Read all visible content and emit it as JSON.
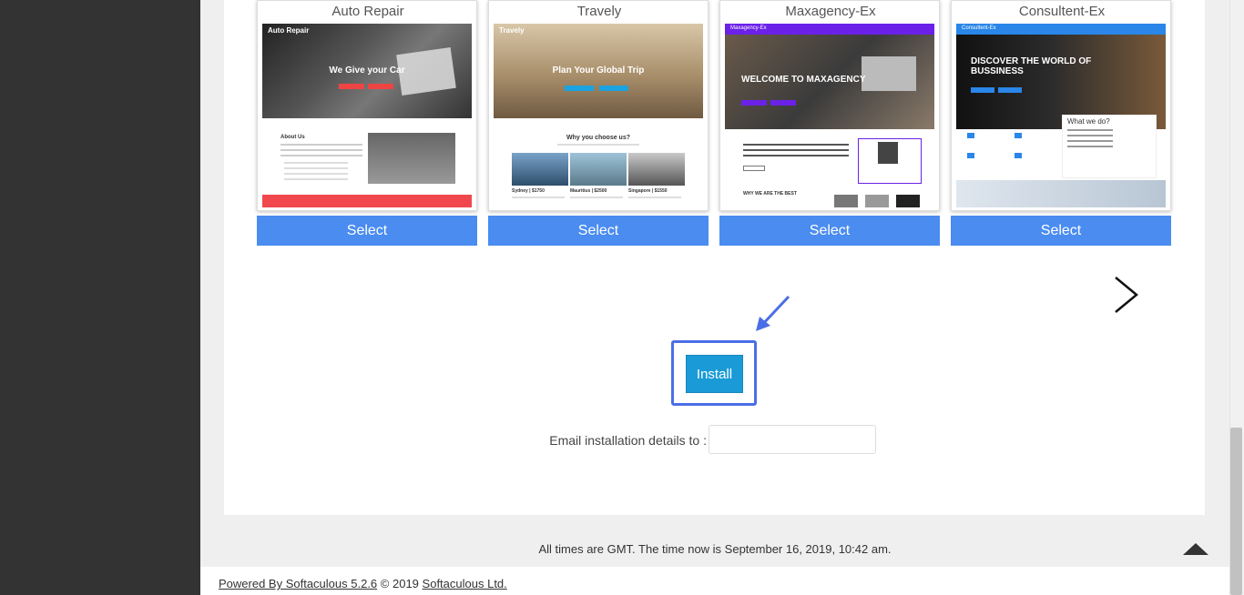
{
  "themes": [
    {
      "title": "Auto Repair",
      "select_label": "Select",
      "hero_text": "We Give your Car",
      "brand": "Auto Repair",
      "section": "About Us"
    },
    {
      "title": "Travely",
      "select_label": "Select",
      "hero_text": "Plan Your Global Trip",
      "brand": "Travely",
      "section": "Why you choose us?",
      "cities": [
        "Sydney | $1750",
        "Mauritius | $2500",
        "Singapore | $1550"
      ]
    },
    {
      "title": "Maxagency-Ex",
      "select_label": "Select",
      "hero_text": "WELCOME TO MAXAGENCY",
      "brand": "Maxagency-Ex",
      "section": "WHY WE ARE THE BEST"
    },
    {
      "title": "Consultent-Ex",
      "select_label": "Select",
      "hero_text": "DISCOVER THE WORLD OF BUSSINESS",
      "brand": "Consultent-Ex",
      "section": "What we do?"
    }
  ],
  "install": {
    "label": "Install"
  },
  "email": {
    "label": "Email installation details to :",
    "value": ""
  },
  "status": {
    "times": "All times are GMT. The time now is September 16, 2019, 10:42 am."
  },
  "footer": {
    "powered_link": "Powered By Softaculous 5.2.6",
    "copyright": "© 2019",
    "company_link": "Softaculous Ltd."
  },
  "colors": {
    "select_blue": "#4a8cf0",
    "install_blue": "#1a9bd7",
    "outline_blue": "#4b6ee6"
  }
}
